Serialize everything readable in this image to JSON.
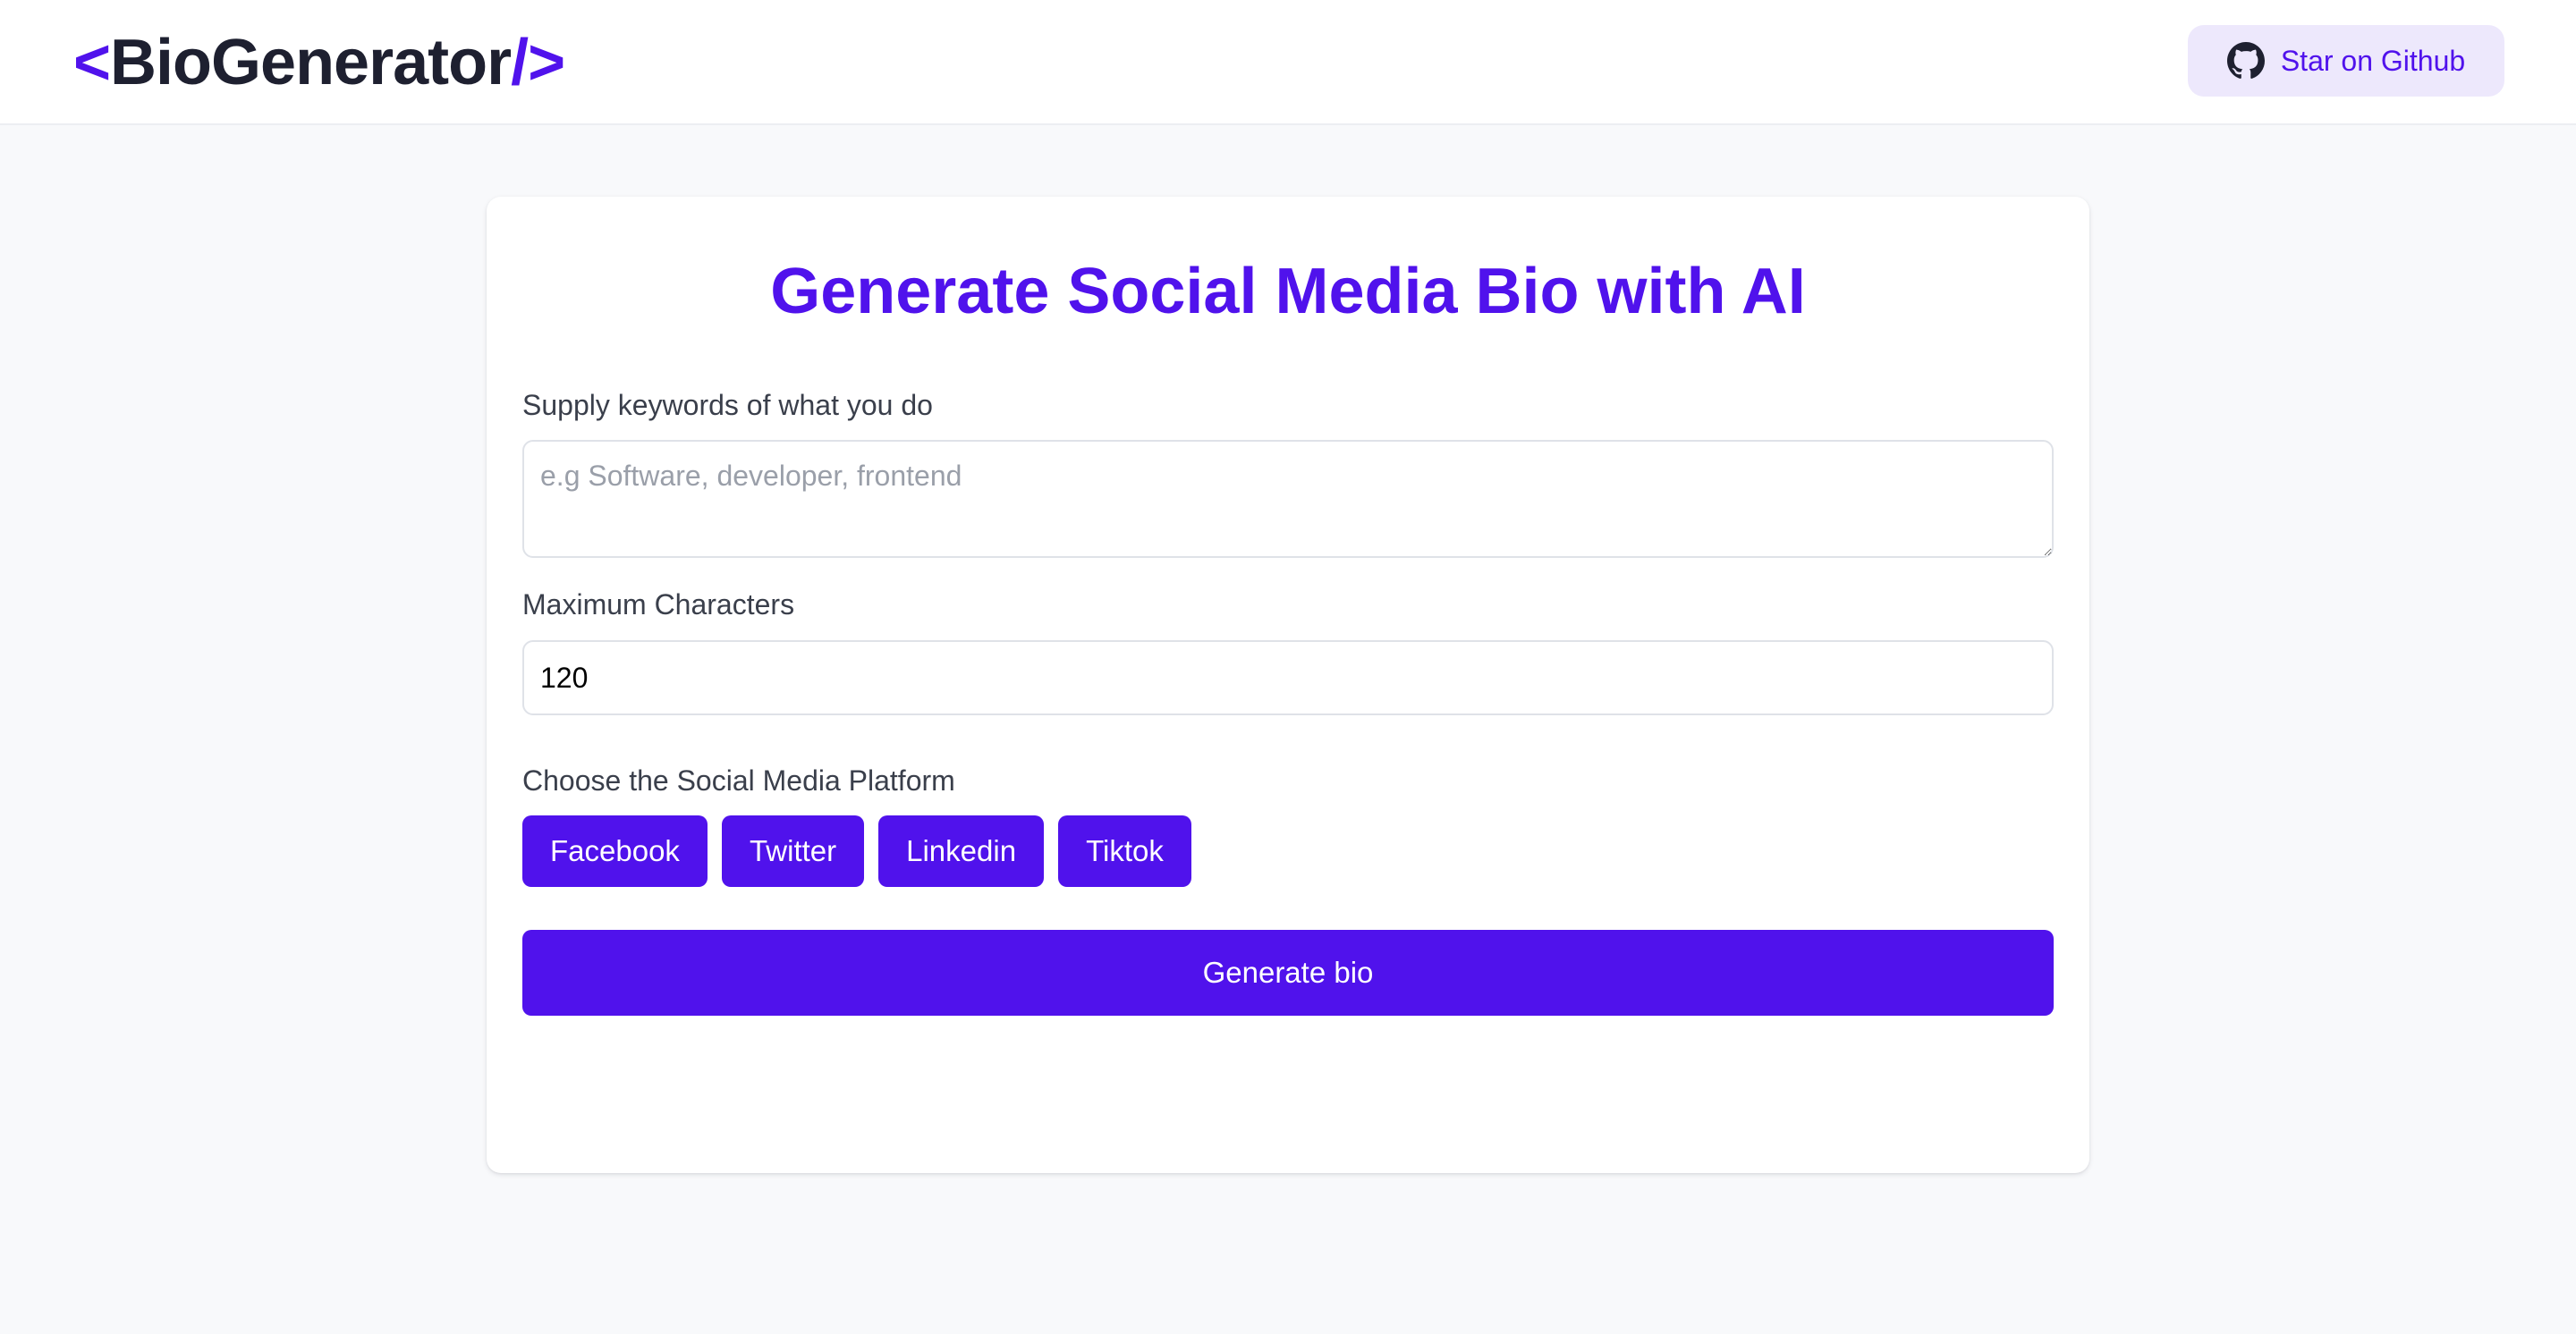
{
  "header": {
    "logo": {
      "prefix": "<",
      "name": "BioGenerator",
      "suffix": "/>"
    },
    "github_button": {
      "icon": "github-icon",
      "label": "Star on Github"
    }
  },
  "main": {
    "title": "Generate Social Media Bio with AI",
    "keywords": {
      "label": "Supply keywords of what you do",
      "placeholder": "e.g Software, developer, frontend",
      "value": ""
    },
    "max_chars": {
      "label": "Maximum Characters",
      "value": "120"
    },
    "platform": {
      "label": "Choose the Social Media Platform",
      "options": [
        "Facebook",
        "Twitter",
        "Linkedin",
        "Tiktok"
      ]
    },
    "generate_button": "Generate bio"
  },
  "colors": {
    "accent": "#5012ec",
    "accent_light": "#ede8fc",
    "text_dark": "#1e2030",
    "background": "#f8f9fb"
  }
}
